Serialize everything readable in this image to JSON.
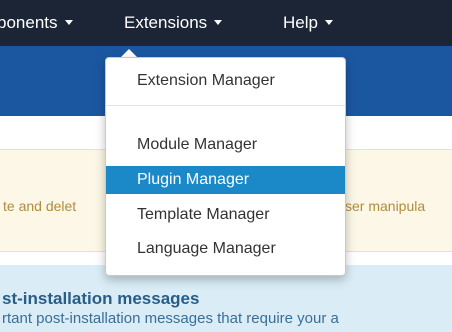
{
  "navbar": {
    "items": [
      {
        "label": "ponents"
      },
      {
        "label": "Extensions"
      },
      {
        "label": "Help"
      }
    ]
  },
  "alert": {
    "text_left": "te and delet",
    "text_right": "ser manipula"
  },
  "info": {
    "title": "st-installation messages",
    "text": "rtant post-installation messages that require your a"
  },
  "dropdown": {
    "items": [
      {
        "label": "Extension Manager"
      },
      {
        "label": "Module Manager"
      },
      {
        "label": "Plugin Manager"
      },
      {
        "label": "Template Manager"
      },
      {
        "label": "Language Manager"
      }
    ]
  },
  "colors": {
    "navbar_bg": "#1c2536",
    "subheader_bg": "#1b57a0",
    "active_item_bg": "#1b88c7",
    "alert_bg": "#fcf7e6",
    "info_bg": "#daedf7"
  }
}
